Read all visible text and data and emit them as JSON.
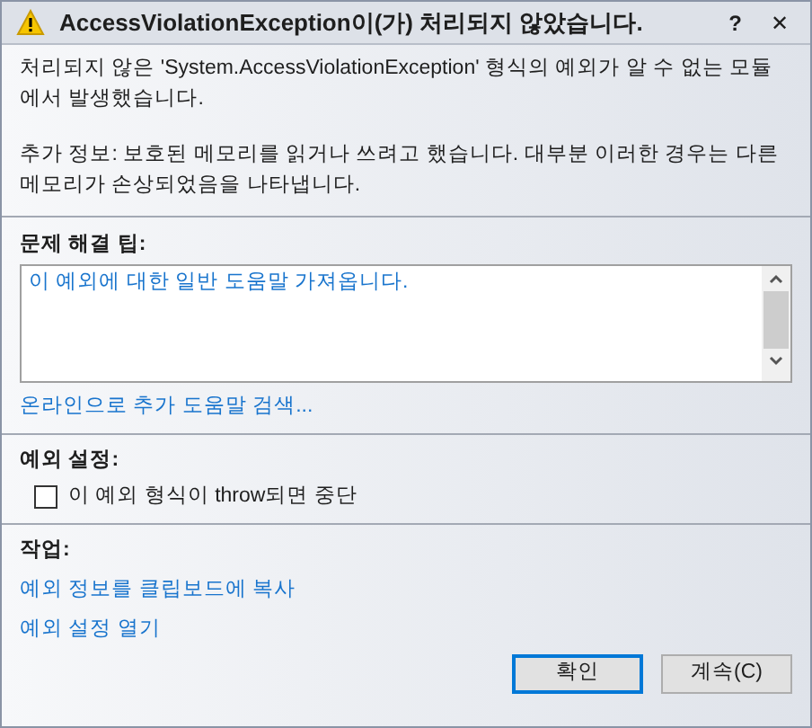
{
  "window": {
    "title": "AccessViolationException이(가) 처리되지 않았습니다.",
    "help": "?",
    "close": "✕"
  },
  "message": [
    "처리되지 않은 'System.AccessViolationException' 형식의 예외가 알 수 없는 모듈에서 발생했습니다.",
    "추가 정보: 보호된 메모리를 읽거나 쓰려고 했습니다. 대부분 이러한 경우는 다른 메모리가 손상되었음을 나타냅니다."
  ],
  "tips": {
    "heading": "문제 해결 팁:",
    "items": [
      "이 예외에 대한 일반 도움말 가져옵니다."
    ],
    "link": "온라인으로 추가 도움말 검색..."
  },
  "settings": {
    "heading": "예외 설정:",
    "checkbox": {
      "label": "이 예외 형식이 throw되면 중단",
      "checked": false
    }
  },
  "actions": {
    "heading": "작업:",
    "links": [
      "예외 정보를 클립보드에 복사",
      "예외 설정 열기"
    ]
  },
  "buttons": [
    {
      "label": "확인",
      "selected": true
    },
    {
      "label": "계속(C)",
      "selected": false
    }
  ]
}
